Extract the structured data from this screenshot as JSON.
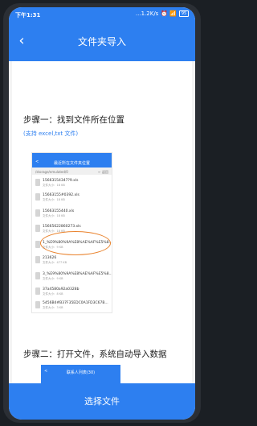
{
  "status_bar": {
    "time": "下午1:31",
    "network": "...1.2K/s",
    "icons": "⏰ 📶 ",
    "battery": "95"
  },
  "header": {
    "back_icon": "chevron-left",
    "title": "文件夹导入"
  },
  "step1": {
    "title": "步骤一：找到文件所在位置",
    "support": "(支持 excel,txt 文件)"
  },
  "screenshot1": {
    "header_back": "<",
    "header_title": "最近所在文件夹位置",
    "path": "/storage/emulated/0",
    "up_label": "← 返回",
    "rows": [
      {
        "name": "15663154347?9.xls",
        "size": "文件大小：18 KB"
      },
      {
        "name": "15663155#0392.xls",
        "size": "文件大小：18 KB"
      },
      {
        "name": "15663155440.xls",
        "size": "文件大小：18 KB"
      },
      {
        "name": "15665622860273.xls",
        "size": "文件大小：18 KB"
      },
      {
        "name": "1_%E9%80%9A%E8%AE%AF%E5%8...",
        "size": "文件大小：9 KB"
      },
      {
        "name": "213626",
        "size": "文件大小：477 KB"
      },
      {
        "name": "3_%E9%80%9A%E8%AE%AF%E5%8...",
        "size": "文件大小：9 KB"
      },
      {
        "name": "37a4580a92a0328b",
        "size": "文件大小：8 KB"
      },
      {
        "name": "5456B4#B37F35EDC0A1FD3C67B...",
        "size": "文件大小：3 KB"
      }
    ]
  },
  "step2": {
    "title": "步骤二：打开文件，系统自动导入数据"
  },
  "screenshot2": {
    "header_back": "<",
    "header_title": "联系人列表(30)"
  },
  "bottom_button": {
    "label": "选择文件"
  }
}
